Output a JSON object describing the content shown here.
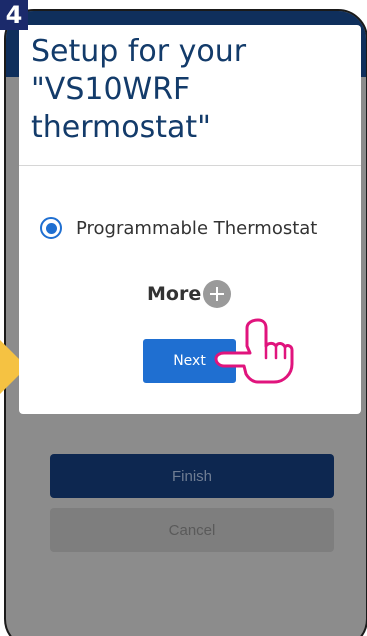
{
  "step": {
    "number": "4"
  },
  "modal": {
    "title": "Setup for your \"VS10WRF thermostat\"",
    "option_label": "Programmable Thermostat",
    "option_selected": true,
    "more_label": "More",
    "next_label": "Next"
  },
  "background": {
    "finish_label": "Finish",
    "cancel_label": "Cancel"
  },
  "icons": {
    "plus": "plus-icon",
    "hand": "pointing-hand-icon",
    "radio": "radio-selected-icon"
  },
  "colors": {
    "header": "#0f2f5c",
    "accent": "#1f6fd1",
    "title": "#133b6a",
    "hand": "#e0147d",
    "pointer": "#f5c242",
    "badge": "#1b2a6b"
  }
}
